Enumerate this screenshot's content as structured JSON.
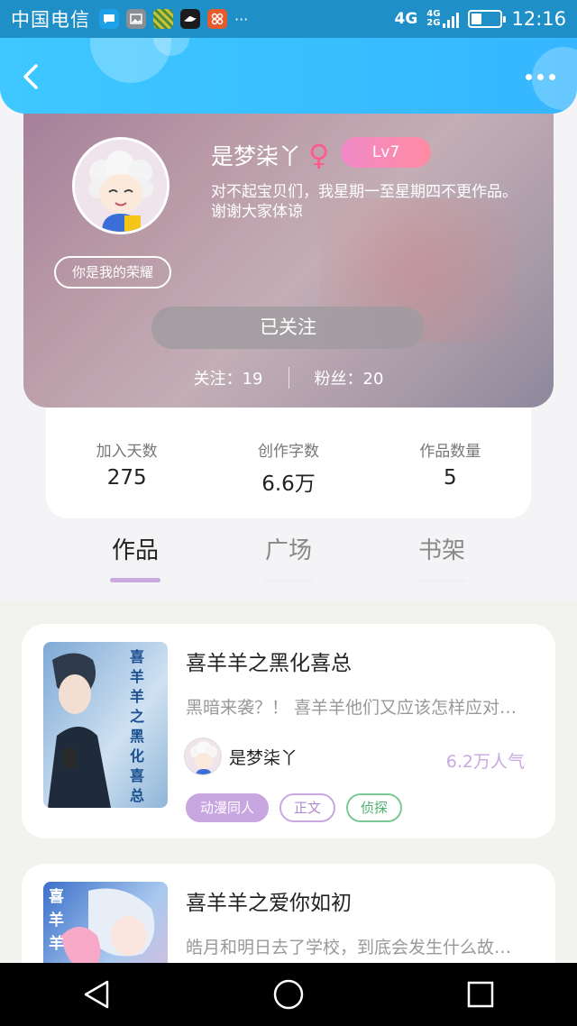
{
  "status_bar": {
    "carrier": "中国电信",
    "network": "4G",
    "network_small": "4G\n2G",
    "time": "12:16",
    "overflow": "···"
  },
  "header": {
    "back_icon": "chevron-left-icon",
    "more_icon": "more-horizontal-icon"
  },
  "profile": {
    "username": "是梦柒丫",
    "gender_symbol": "♀",
    "level": "Lv7",
    "bio": "对不起宝贝们，我星期一至星期四不更作品。谢谢大家体谅",
    "badge": "你是我的荣耀",
    "follow_button": "已关注",
    "following_label": "关注：",
    "following_count": "19",
    "fans_label": "粉丝：",
    "fans_count": "20"
  },
  "stats": [
    {
      "label": "加入天数",
      "value": "275"
    },
    {
      "label": "创作字数",
      "value": "6.6万"
    },
    {
      "label": "作品数量",
      "value": "5"
    }
  ],
  "tabs": [
    {
      "label": "作品",
      "active": true
    },
    {
      "label": "广场",
      "active": false
    },
    {
      "label": "书架",
      "active": false
    }
  ],
  "works": [
    {
      "title": "喜羊羊之黑化喜总",
      "cover_text": "喜羊羊之黑化喜总",
      "description": "黑暗来袭？！ 喜羊羊他们又应该怎样应对…",
      "author": "是梦柒丫",
      "popularity": "6.2万人气",
      "tags": [
        "动漫同人",
        "正文",
        "侦探"
      ]
    },
    {
      "title": "喜羊羊之爱你如初",
      "cover_text": "喜羊羊",
      "description": "皓月和明日去了学校，到底会发生什么故…"
    }
  ],
  "colors": {
    "header": "#3ec8ff",
    "accent": "#c9a9e0",
    "level_badge": "#f08ac8",
    "tag_green": "#7cc995"
  }
}
